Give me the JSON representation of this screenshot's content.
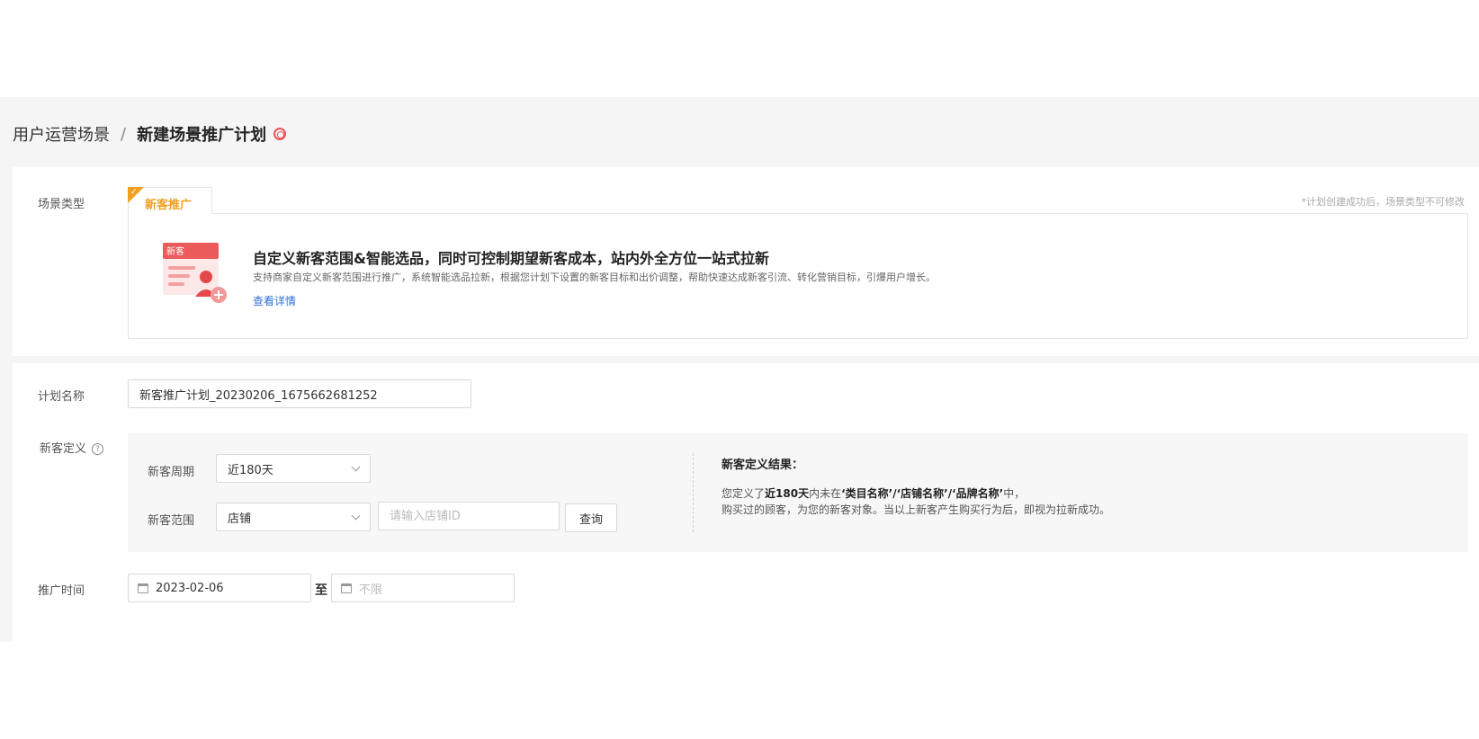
{
  "breadcrumb": {
    "parent": "用户运营场景",
    "separator": "/",
    "current": "新建场景推广计划"
  },
  "scene": {
    "label": "场景类型",
    "tab_label": "新客推广",
    "note": "*计划创建成功后，场景类型不可修改",
    "icon_badge": "新客",
    "title": "自定义新客范围&智能选品，同时可控制期望新客成本，站内外全方位一站式拉新",
    "description": "支持商家自定义新客范围进行推广，系统智能选品拉新，根据您计划下设置的新客目标和出价调整，帮助快速达成新客引流、转化营销目标，引爆用户增长。",
    "link": "查看详情"
  },
  "plan_name": {
    "label": "计划名称",
    "value": "新客推广计划_20230206_1675662681252"
  },
  "new_customer": {
    "label": "新客定义",
    "cycle_label": "新客周期",
    "cycle_value": "近180天",
    "scope_label": "新客范围",
    "scope_value": "店铺",
    "shop_id_placeholder": "请输入店铺ID",
    "query_button": "查询",
    "result_title": "新客定义结果：",
    "result_line1_prefix": "您定义了",
    "result_line1_period": "近180天",
    "result_line1_mid": "内未在",
    "result_line1_names": "‘类目名称’/‘店铺名称’/‘品牌名称’",
    "result_line1_suffix": "中，",
    "result_line2": "购买过的顾客，为您的新客对象。当以上新客产生购买行为后，即视为拉新成功。"
  },
  "promo_time": {
    "label": "推广时间",
    "start": "2023-02-06",
    "to": "至",
    "end_placeholder": "不限"
  },
  "colors": {
    "accent_orange": "#f0a020",
    "link_blue": "#2f6fd6",
    "brand_red": "#e8545a"
  }
}
